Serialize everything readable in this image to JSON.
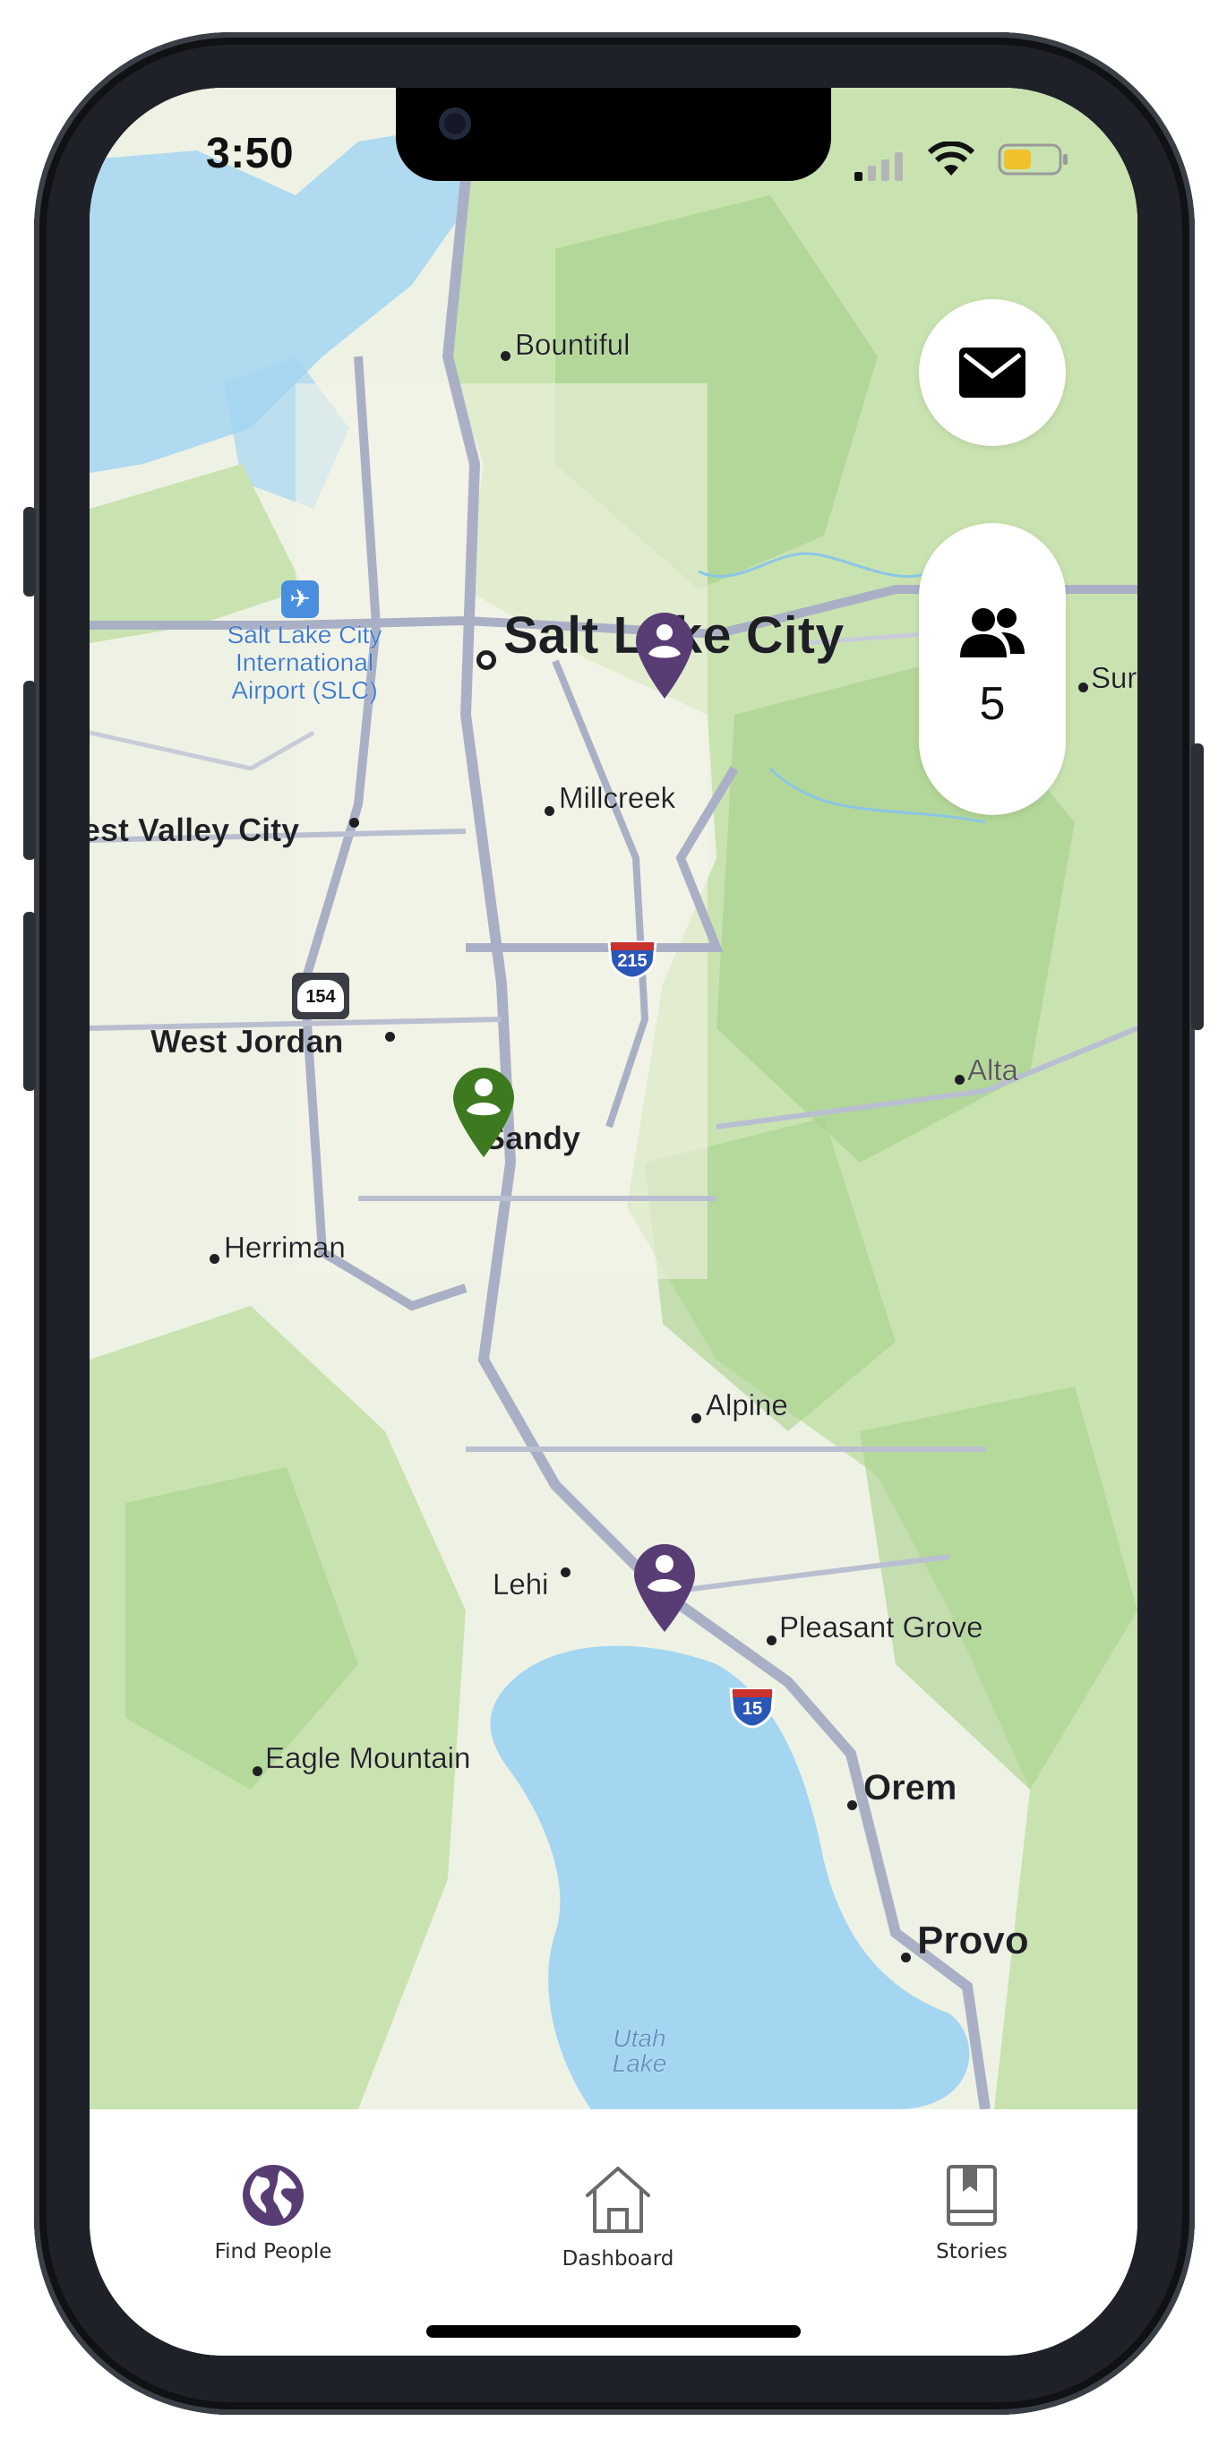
{
  "status_bar": {
    "time": "3:50"
  },
  "map": {
    "places": {
      "bountiful": "Bountiful",
      "salt_lake_city": "Salt Lake City",
      "airport": "Salt Lake City\nInternational\nAirport (SLC)",
      "west_valley_city": "est Valley City",
      "millcreek": "Millcreek",
      "west_jordan": "West Jordan",
      "sandy": "Sandy",
      "alta": "Alta",
      "herriman": "Herriman",
      "alpine": "Alpine",
      "lehi": "Lehi",
      "pleasant_grove": "Pleasant Grove",
      "eagle_mountain": "Eagle Mountain",
      "orem": "Orem",
      "provo": "Provo",
      "sun": "Sur",
      "utah_lake": "Utah\nLake"
    },
    "shields": {
      "i215": "215",
      "i15": "15",
      "route154": "154"
    },
    "colors": {
      "land": "#eef2e4",
      "green": "#c9e3b0",
      "dark_green": "#a9d18e",
      "water": "#a4d6f1",
      "highway": "#a9b0c6"
    }
  },
  "floating": {
    "mail_icon": "envelope-icon",
    "people_icon": "people-group-icon",
    "people_count": "5"
  },
  "pins": [
    {
      "name": "person-pin-slc",
      "color": "#583d75"
    },
    {
      "name": "person-pin-sandy",
      "color": "#3d7a1f"
    },
    {
      "name": "person-pin-lehi",
      "color": "#583d75"
    }
  ],
  "tabs": [
    {
      "label": "Find People",
      "icon": "globe-icon",
      "active": true,
      "color": "#583d75"
    },
    {
      "label": "Dashboard",
      "icon": "home-icon",
      "active": false
    },
    {
      "label": "Stories",
      "icon": "book-icon",
      "active": false
    }
  ]
}
